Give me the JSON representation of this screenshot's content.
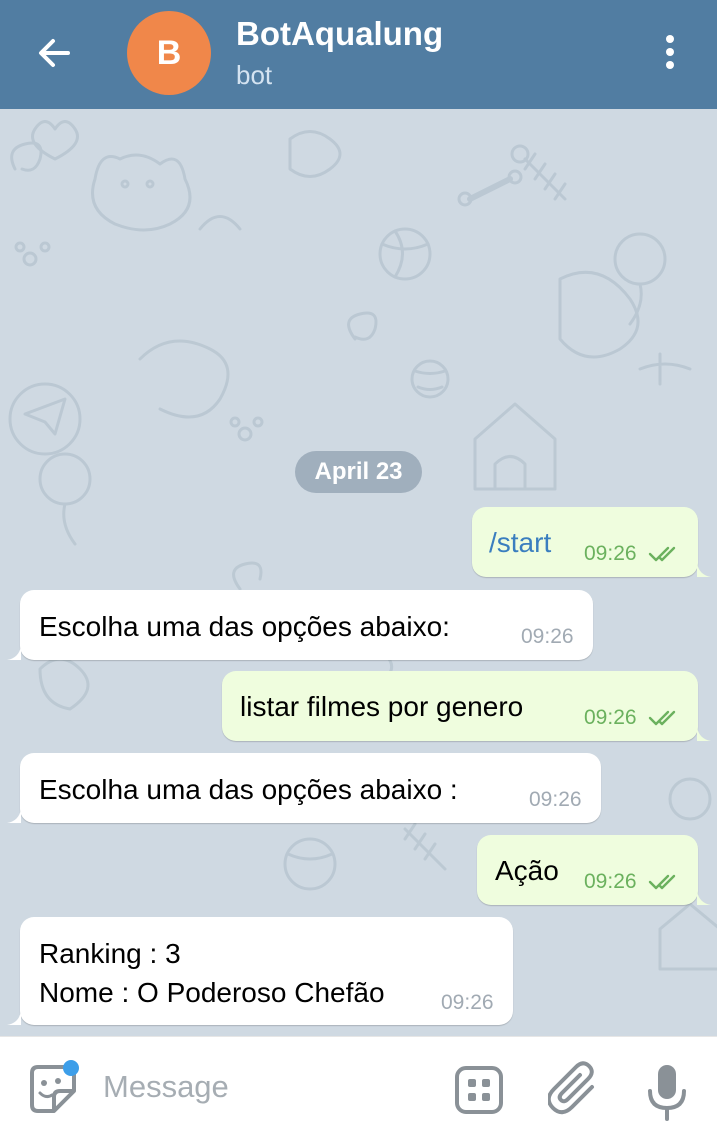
{
  "header": {
    "title": "BotAqualung",
    "subtitle": "bot",
    "avatar_letter": "B",
    "back_icon": "arrow-left-icon",
    "menu_icon": "more-vertical-icon"
  },
  "chat": {
    "date_label": "April 23",
    "messages": [
      {
        "direction": "out",
        "text": "/start",
        "time": "09:26",
        "status_icon": "double-check-icon"
      },
      {
        "direction": "in",
        "text": "Escolha uma das opções abaixo:",
        "time": "09:26"
      },
      {
        "direction": "out",
        "text": "listar filmes por genero",
        "time": "09:26",
        "status_icon": "double-check-icon"
      },
      {
        "direction": "in",
        "text": "Escolha uma das opções abaixo :",
        "time": "09:26"
      },
      {
        "direction": "out",
        "text": "Ação",
        "time": "09:26",
        "status_icon": "double-check-icon"
      },
      {
        "direction": "in",
        "lines": [
          "Ranking : 3",
          "Nome : O Poderoso Chefão"
        ],
        "time": "09:26"
      }
    ]
  },
  "input_bar": {
    "placeholder": "Message",
    "value": "",
    "sticker_icon": "sticker-icon",
    "commands_icon": "bot-commands-icon",
    "attach_icon": "paperclip-icon",
    "mic_icon": "microphone-icon"
  },
  "colors": {
    "header_bg": "#517da2",
    "avatar_bg": "#f0874a",
    "chat_bg": "#cfd9e2",
    "outgoing_bubble": "#effdde",
    "incoming_bubble": "#ffffff",
    "outgoing_time": "#6bb15e",
    "incoming_time": "#a1aab3",
    "command_link": "#3a7ebf",
    "unread_dot": "#3d9ee9"
  }
}
